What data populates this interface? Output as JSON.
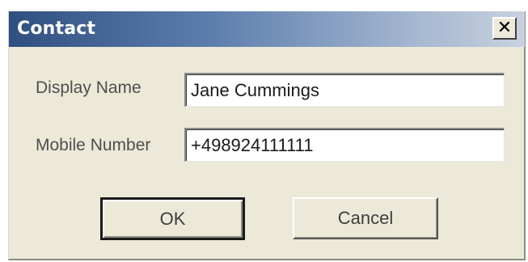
{
  "window": {
    "title": "Contact",
    "close_glyph": "✕",
    "close_icon": "close-icon"
  },
  "form": {
    "display_name": {
      "label": "Display Name",
      "value": "Jane Cummings"
    },
    "mobile_number": {
      "label": "Mobile Number",
      "value": "+498924111111"
    }
  },
  "buttons": {
    "ok_label": "OK",
    "cancel_label": "Cancel"
  },
  "colors": {
    "titlebar_start": "#2f4f80",
    "titlebar_end": "#c8d1df",
    "dialog_background": "#ece9d8"
  }
}
